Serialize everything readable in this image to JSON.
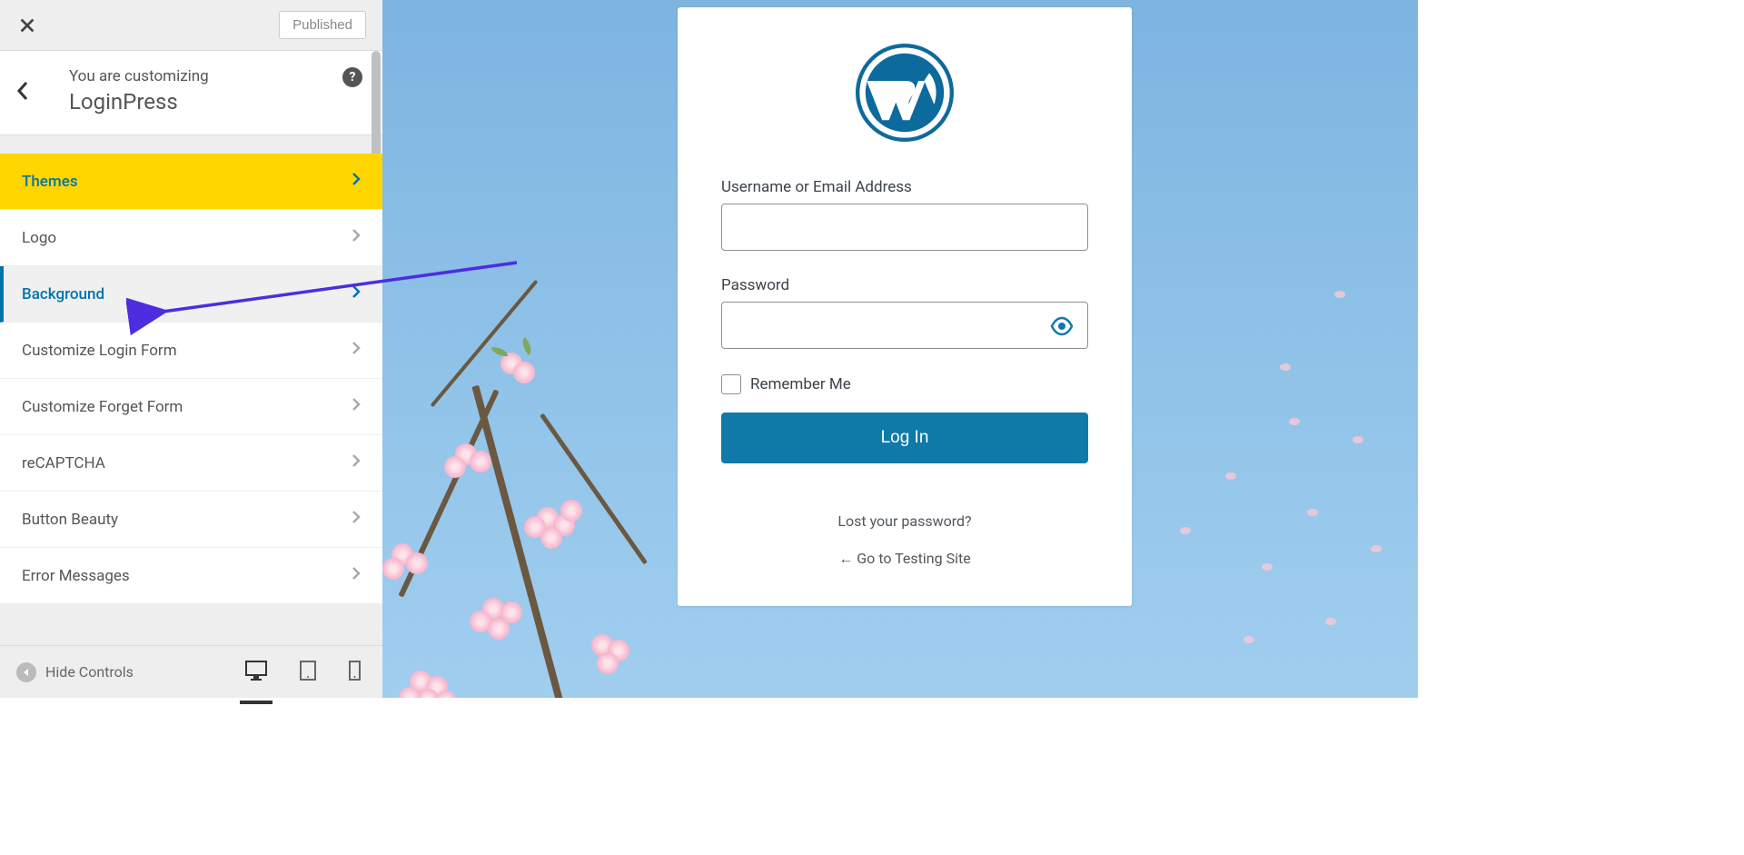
{
  "topbar": {
    "published_label": "Published"
  },
  "header": {
    "customizing_label": "You are customizing",
    "panel_title": "LoginPress"
  },
  "menu": {
    "items": [
      {
        "label": "Themes",
        "variant": "themes"
      },
      {
        "label": "Logo",
        "variant": ""
      },
      {
        "label": "Background",
        "variant": "active"
      },
      {
        "label": "Customize Login Form",
        "variant": ""
      },
      {
        "label": "Customize Forget Form",
        "variant": ""
      },
      {
        "label": "reCAPTCHA",
        "variant": ""
      },
      {
        "label": "Button Beauty",
        "variant": ""
      },
      {
        "label": "Error Messages",
        "variant": ""
      }
    ]
  },
  "bottom": {
    "hide_controls_label": "Hide Controls"
  },
  "login": {
    "username_label": "Username or Email Address",
    "password_label": "Password",
    "remember_label": "Remember Me",
    "button_label": "Log In",
    "lost_password": "Lost your password?",
    "back_link": "← Go to Testing Site"
  }
}
